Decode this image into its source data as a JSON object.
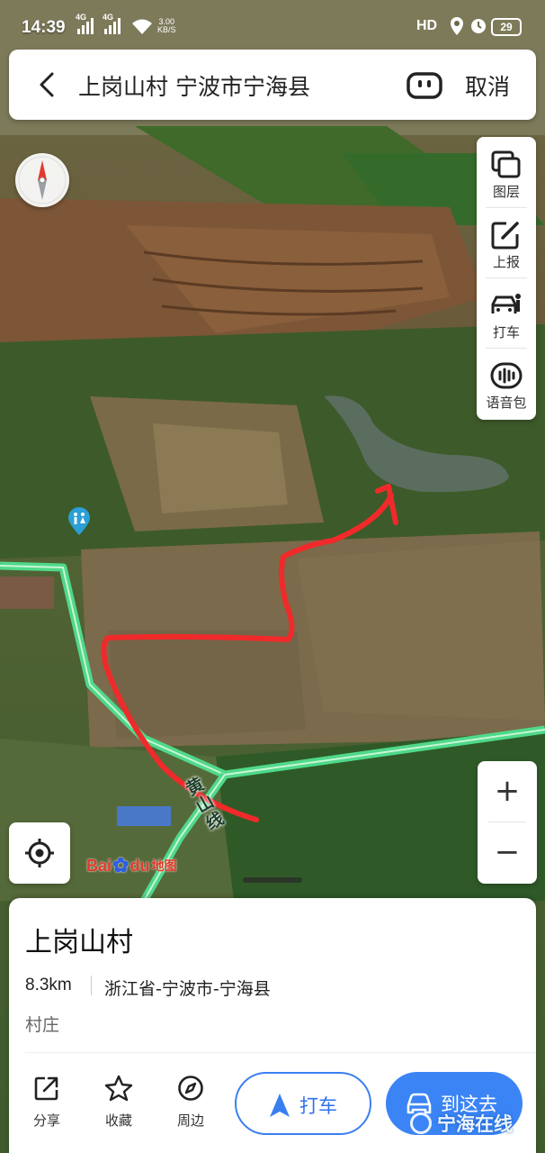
{
  "status_bar": {
    "time": "14:39",
    "network_1": "4G",
    "network_2": "4G",
    "net_speed": "3.00",
    "net_unit": "KB/S",
    "hd_label": "HD",
    "battery": "29"
  },
  "search_bar": {
    "query": "上岗山村 宁波市宁海县",
    "cancel_label": "取消"
  },
  "toolbar": {
    "items": [
      {
        "label": "图层",
        "icon": "layers-icon"
      },
      {
        "label": "上报",
        "icon": "report-edit-icon"
      },
      {
        "label": "打车",
        "icon": "taxi-icon"
      },
      {
        "label": "语音包",
        "icon": "voice-pack-icon"
      }
    ]
  },
  "map": {
    "road_label": "黄山线",
    "logo_text_bai": "Bai",
    "logo_text_du": "du",
    "logo_text_map": "地图",
    "colors": {
      "road_green": "#4fd98a",
      "route_red": "#f02a2a",
      "water": "#5b6d5e"
    }
  },
  "zoom": {
    "plus": "+",
    "minus": "−"
  },
  "place_card": {
    "name": "上岗山村",
    "distance": "8.3km",
    "address": "浙江省-宁波市-宁海县",
    "category": "村庄",
    "actions": [
      {
        "label": "分享",
        "icon": "share-icon"
      },
      {
        "label": "收藏",
        "icon": "star-icon"
      },
      {
        "label": "周边",
        "icon": "compass-nearby-icon"
      }
    ],
    "taxi_button": "打车",
    "go_button": "到这去",
    "accent_color": "#3b84f5"
  },
  "watermark": "宁海在线"
}
